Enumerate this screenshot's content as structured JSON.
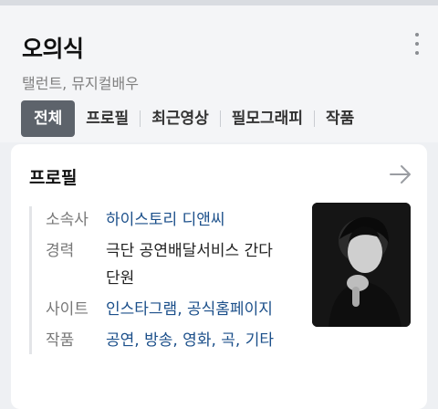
{
  "header": {
    "name": "오의식",
    "subtitle": "탤런트, 뮤지컬배우"
  },
  "tabs": [
    "전체",
    "프로필",
    "최근영상",
    "필모그래피",
    "작품"
  ],
  "profile": {
    "heading": "프로필",
    "rows": [
      {
        "label": "소속사",
        "value": "하이스토리 디앤씨",
        "link": true
      },
      {
        "label": "경력",
        "value": "극단 공연배달서비스 간다 단원",
        "link": false
      },
      {
        "label": "사이트",
        "value": "인스타그램, 공식홈페이지",
        "link": true
      },
      {
        "label": "작품",
        "value": "공연, 방송, 영화, 곡, 기타",
        "link": true
      }
    ]
  },
  "colors": {
    "active_tab": "#5d636b",
    "link": "#1b4f8a",
    "background": "#eef0f3"
  },
  "icons": {
    "more": "kebab-menu-icon",
    "profile_link": "arrow-right-icon"
  }
}
